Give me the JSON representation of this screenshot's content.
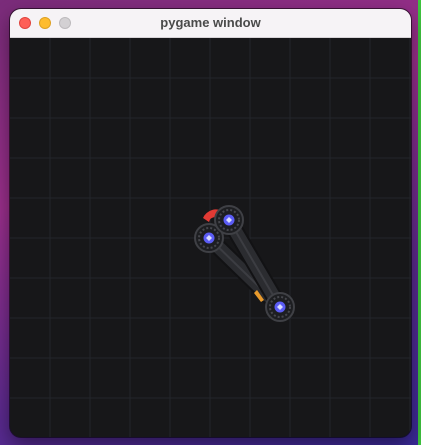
{
  "window": {
    "title": "pygame window"
  },
  "colors": {
    "canvas_background": "#171719",
    "grid_line": "#23252a",
    "link_body": "#2b2c30",
    "joint_core": "#5b5cf5",
    "end_effector": "#e23a34",
    "accent": "#e89a2c"
  },
  "icons": {
    "close": "close-icon",
    "minimize": "minimize-icon",
    "zoom": "zoom-icon"
  }
}
